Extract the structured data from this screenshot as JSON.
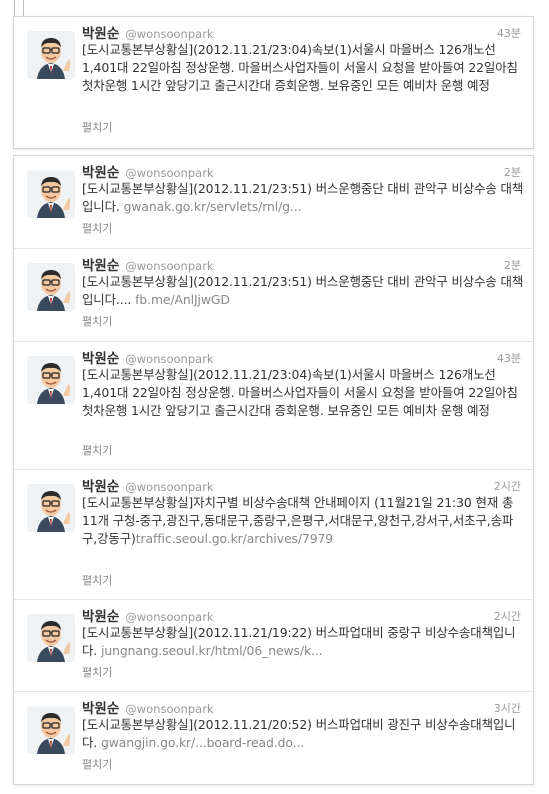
{
  "user": {
    "name": "박원순",
    "handle": "@wonsoonpark"
  },
  "expand_label": "펼치기",
  "tweets": [
    {
      "time": "43분",
      "text": "[도시교통본부상황실](2012.11.21/23:04)속보(1)서울시 마을버스 126개노선 1,401대 22일아침 정상운행. 마을버스사업자들이 서울시 요청을 받아들여 22일아침 첫차운행 1시간 앞당기고 출근시간대 증회운행. 보유중인 모든 예비차 운행 예정",
      "link": ""
    },
    {
      "time": "2분",
      "text": "[도시교통본부상황실](2012.11.21/23:51) 버스운행중단 대비 관악구 비상수송 대책입니다. ",
      "link": "gwanak.go.kr/servlets/rnl/g..."
    },
    {
      "time": "2분",
      "text": "[도시교통본부상황실](2012.11.21/23:51) 버스운행중단 대비 관악구 비상수송 대책입니다.... ",
      "link": "fb.me/AnlJjwGD"
    },
    {
      "time": "43분",
      "text": "[도시교통본부상황실](2012.11.21/23:04)속보(1)서울시 마을버스 126개노선 1,401대 22일아침 정상운행. 마을버스사업자들이 서울시 요청을 받아들여 22일아침 첫차운행 1시간 앞당기고 출근시간대 증회운행. 보유중인 모든 예비차 운행 예정",
      "link": ""
    },
    {
      "time": "2시간",
      "text": "[도시교통본부상황실]자치구별 비상수송대책 안내페이지 (11월21일 21:30 현재 총 11개 구청-중구,광진구,동대문구,중랑구,은평구,서대문구,양천구,강서구,서초구,송파구,강동구)",
      "link": "traffic.seoul.go.kr/archives/7979"
    },
    {
      "time": "2시간",
      "text": "[도시교통본부상황실](2012.11.21/19:22) 버스파업대비 중랑구 비상수송대책입니다. ",
      "link": "jungnang.seoul.kr/html/06_news/k..."
    },
    {
      "time": "3시간",
      "text": "[도시교통본부상황실](2012.11.21/20:52) 버스파업대비 광진구 비상수송대책입니다. ",
      "link": "gwangjin.go.kr/...board-read.do..."
    }
  ]
}
